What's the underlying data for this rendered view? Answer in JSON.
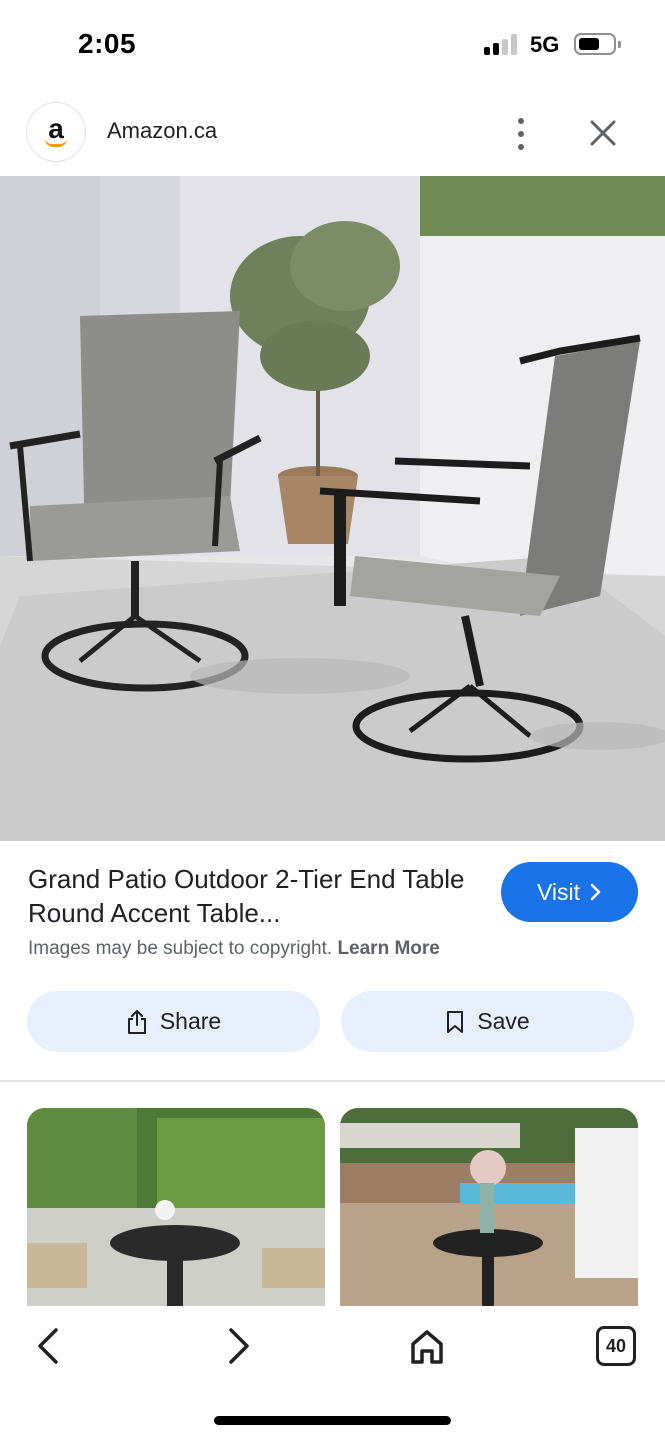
{
  "status_bar": {
    "time": "2:05",
    "network": "5G",
    "signal_bars_active": 2,
    "signal_bars_total": 4,
    "battery_level": 0.5
  },
  "header": {
    "site_logo_letter": "a",
    "site_name": "Amazon.ca",
    "more_icon": "more-vert-icon",
    "close_icon": "close-icon"
  },
  "product": {
    "title": "Grand Patio Outdoor 2-Tier End Table Round Accent Table...",
    "visit_label": "Visit",
    "visit_chevron": "›",
    "copyright_text": "Images may be subject to copyright.",
    "learn_more_label": "Learn More"
  },
  "actions": {
    "share_label": "Share",
    "save_label": "Save"
  },
  "bottom_nav": {
    "back_icon": "chevron-left-icon",
    "forward_icon": "chevron-right-icon",
    "home_icon": "home-icon",
    "tab_count": "40"
  },
  "colors": {
    "accent": "#1a73e8",
    "chip_bg": "#e8f0fe",
    "amazon_orange": "#f59b00"
  }
}
